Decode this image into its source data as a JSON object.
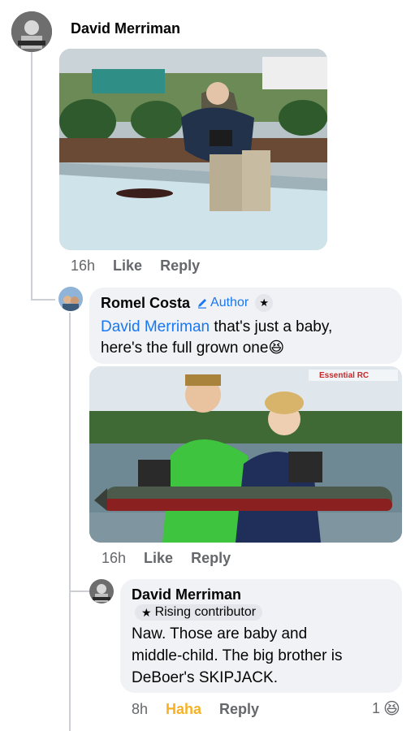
{
  "comments": [
    {
      "author": "David Merriman",
      "time": "16h",
      "like_label": "Like",
      "reply_label": "Reply"
    },
    {
      "author": "Romel Costa",
      "author_badge": "Author",
      "mention": "David Merriman",
      "text_line1": " that's just a baby,",
      "text_line2": "here's the full grown one",
      "emoji": "😆",
      "photo_watermark": "Essential RC",
      "time": "16h",
      "like_label": "Like",
      "reply_label": "Reply"
    },
    {
      "author": "David Merriman",
      "badge_label": "Rising contributor",
      "text_line1": "Naw. Those are baby and",
      "text_line2": "middle-child. The big brother is",
      "text_line3": "DeBoer's SKIPJACK.",
      "time": "8h",
      "reaction_label": "Haha",
      "reply_label": "Reply",
      "reaction_count": "1",
      "reaction_emoji": "😆"
    }
  ],
  "colors": {
    "link": "#1877f2",
    "haha": "#f7b125",
    "bubble": "#f0f2f5",
    "meta": "#65676b"
  }
}
